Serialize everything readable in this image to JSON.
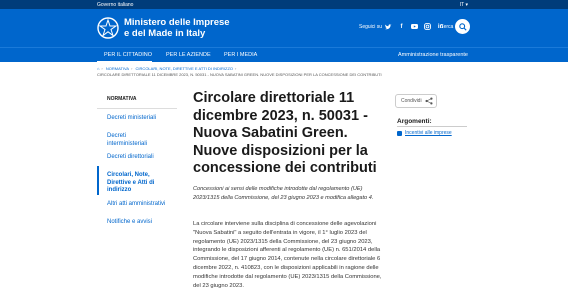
{
  "topbar": {
    "gov_label": "Governo italiano",
    "lang_label": "IT ▾"
  },
  "header": {
    "ministry_line1": "Ministero delle Imprese",
    "ministry_line2": "e del Made in Italy",
    "social_label": "Seguici su",
    "social_icons": [
      "twitter-icon",
      "facebook-icon",
      "youtube-icon",
      "instagram-icon",
      "linkedin-icon"
    ],
    "search_label": "Cerca"
  },
  "nav": {
    "items": [
      "Per il cittadino",
      "Per le aziende",
      "Per i media"
    ],
    "right_link": "Amministrazione trasparente"
  },
  "breadcrumb": {
    "items": [
      "Normativa",
      "Circolari, Note, Direttive e Atti di indirizzo"
    ],
    "current": "Circolare direttoriale 11 dicembre 2023, n. 50031 - Nuova Sabatini Green. Nuove disposizioni per la concessione dei contributi"
  },
  "sidebar": {
    "heading": "Normativa",
    "items": [
      "Decreti ministeriali",
      "Decreti interministeriali",
      "Decreti direttoriali",
      "Circolari, Note, Direttive e Atti di indirizzo",
      "Altri atti amministrativi",
      "Notifiche e avvisi"
    ]
  },
  "article": {
    "title": "Circolare direttoriale 11 dicembre 2023, n. 50031 - Nuova Sabatini Green. Nuove disposizioni per la concessione dei contributi",
    "subtitle": "Concessioni ai sensi delle modifiche introdotte dal regolamento (UE) 2023/1315 della Commissione, del 23 giugno 2023 e modifica allegato 4.",
    "body": "La circolare interviene sulla disciplina di concessione delle agevolazioni \"Nuova Sabatini\" a seguito dell'entrata in vigore, il 1° luglio 2023 del regolamento (UE) 2023/1315 della Commissione, del 23 giugno 2023, integrando le disposizioni afferenti al regolamento (UE) n. 651/2014 della Commissione, del 17 giugno 2014, contenute nella circolare direttoriale 6 dicembre 2022, n. 410823, con le disposizioni applicabili in ragione delle modifiche introdotte dal regolamento (UE) 2023/1315 della Commissione, del 23 giugno 2023."
  },
  "aside": {
    "share_label": "Condividi",
    "args_label": "Argomenti:",
    "args_item": "Incentivi alle imprese"
  },
  "colors": {
    "brand_blue": "#0066cc",
    "top_bar": "#003c7a"
  }
}
